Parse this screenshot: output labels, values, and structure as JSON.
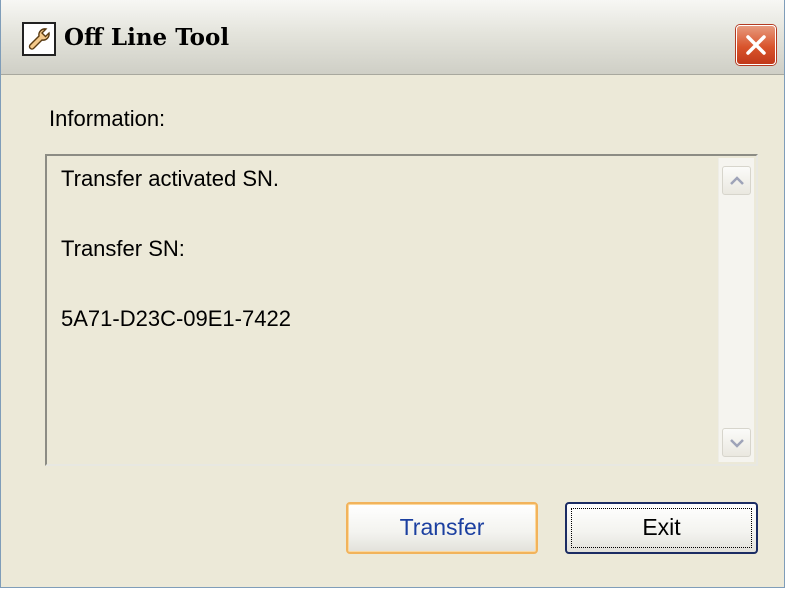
{
  "window": {
    "title": "Off Line Tool"
  },
  "titlebar": {
    "app_icon": "wrench-icon",
    "close_icon": "close-icon",
    "close_color": "#d9542c"
  },
  "info": {
    "label": "Information:",
    "lines": [
      "Transfer activated SN.",
      "Transfer SN:",
      "5A71-D23C-09E1-7422"
    ]
  },
  "scrollbar": {
    "up_icon": "chevron-up-icon",
    "down_icon": "chevron-down-icon"
  },
  "buttons": {
    "transfer_label": "Transfer",
    "exit_label": "Exit"
  },
  "colors": {
    "window_bg": "#ece9d8",
    "focus_border": "#f2b35b",
    "default_border": "#1b2c63",
    "transfer_text": "#1b3fa0"
  }
}
